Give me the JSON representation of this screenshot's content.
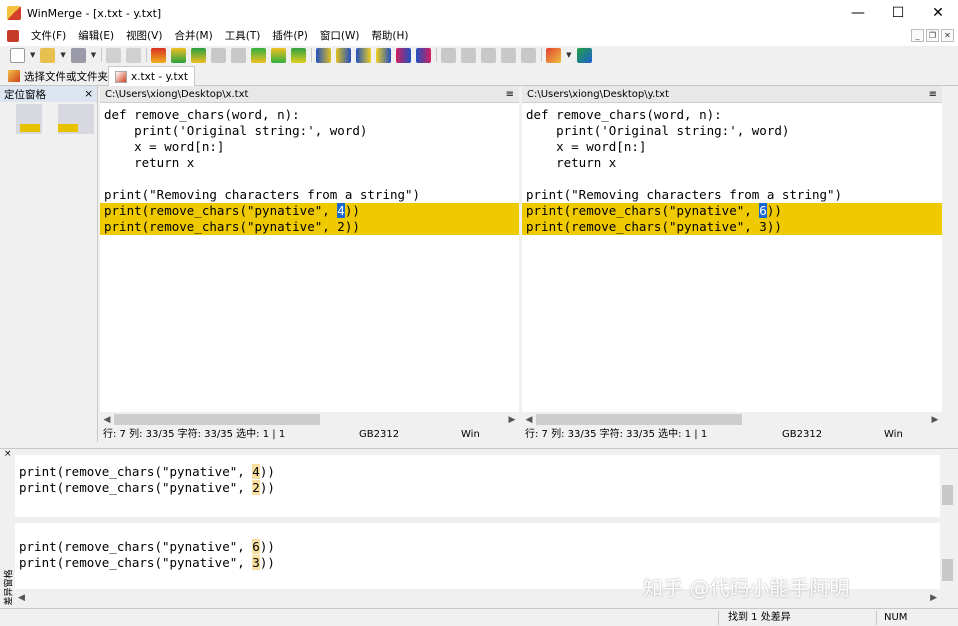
{
  "window": {
    "title": "WinMerge - [x.txt - y.txt]",
    "minimize": "—",
    "maximize": "☐",
    "close": "✕"
  },
  "menu": {
    "items": [
      "文件(F)",
      "编辑(E)",
      "视图(V)",
      "合并(M)",
      "工具(T)",
      "插件(P)",
      "窗口(W)",
      "帮助(H)"
    ]
  },
  "tabs": {
    "folder_tab": "选择文件或文件夹",
    "compare_tab": "x.txt - y.txt"
  },
  "location_pane": {
    "title": "定位窗格",
    "close": "×"
  },
  "left": {
    "path": "C:\\Users\\xiong\\Desktop\\x.txt",
    "menu_glyph": "≡",
    "lines": [
      "def remove_chars(word, n):",
      "    print('Original string:', word)",
      "    x = word[n:]",
      "    return x",
      "",
      "print(\"Removing characters from a string\")",
      "print(remove_chars(\"pynative\", 4))",
      "print(remove_chars(\"pynative\", 2))"
    ],
    "status": {
      "pos": "行: 7  列: 33/35  字符: 33/35  选中: 1 | 1",
      "encoding": "GB2312",
      "eol": "Win"
    },
    "diff_before": "print(remove_chars(\"pynative\", ",
    "diff_values": [
      "4",
      "2"
    ],
    "diff_after": "))"
  },
  "right": {
    "path": "C:\\Users\\xiong\\Desktop\\y.txt",
    "menu_glyph": "≡",
    "lines": [
      "def remove_chars(word, n):",
      "    print('Original string:', word)",
      "    x = word[n:]",
      "    return x",
      "",
      "print(\"Removing characters from a string\")",
      "print(remove_chars(\"pynative\", 6))",
      "print(remove_chars(\"pynative\", 3))"
    ],
    "status": {
      "pos": "行: 7  列: 33/35  字符: 33/35  选中: 1 | 1",
      "encoding": "GB2312",
      "eol": "Win"
    },
    "diff_before": "print(remove_chars(\"pynative\", ",
    "diff_values": [
      "6",
      "3"
    ],
    "diff_after": "))"
  },
  "diff_pane": {
    "close": "×",
    "label": "差异窗格"
  },
  "watermark": "知乎 @代码小能手阿明",
  "statusbar": {
    "found": "找到 1 处差异",
    "num": "NUM"
  },
  "colors": {
    "diff": "#efca00",
    "selection": "#1868d0",
    "word_change": "#f9e0a0"
  }
}
